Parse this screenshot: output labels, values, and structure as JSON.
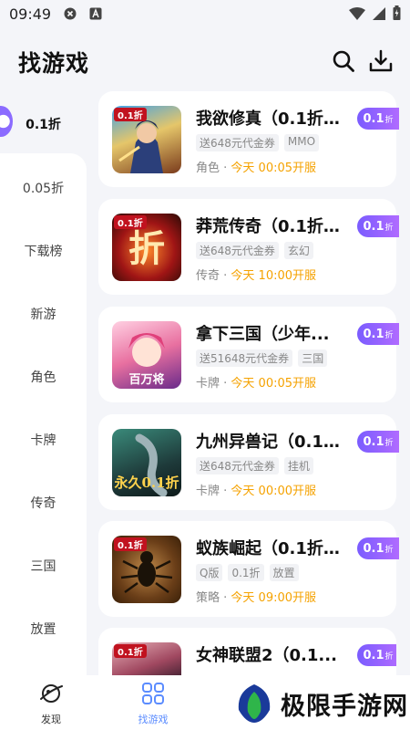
{
  "status": {
    "time": "09:49"
  },
  "header": {
    "title": "找游戏"
  },
  "sidebar": {
    "items": [
      {
        "label": "0.1折",
        "active": true
      },
      {
        "label": "0.05折"
      },
      {
        "label": "下载榜"
      },
      {
        "label": "新游"
      },
      {
        "label": "角色"
      },
      {
        "label": "卡牌"
      },
      {
        "label": "传奇"
      },
      {
        "label": "三国"
      },
      {
        "label": "放置"
      }
    ]
  },
  "games": [
    {
      "name": "我欲修真（0.1折...",
      "tags": [
        "送648元代金券",
        "MMO"
      ],
      "category": "角色",
      "open": "今天 00:05开服",
      "discount": "0.1",
      "discount_unit": "折"
    },
    {
      "name": "莽荒传奇（0.1折...",
      "tags": [
        "送648元代金券",
        "玄幻"
      ],
      "category": "传奇",
      "open": "今天 10:00开服",
      "discount": "0.1",
      "discount_unit": "折"
    },
    {
      "name": "拿下三国（少年...",
      "tags": [
        "送51648元代金券",
        "三国"
      ],
      "category": "卡牌",
      "open": "今天 00:05开服",
      "discount": "0.1",
      "discount_unit": "折"
    },
    {
      "name": "九州异兽记（0.1...",
      "tags": [
        "送648元代金券",
        "挂机"
      ],
      "category": "卡牌",
      "open": "今天 00:00开服",
      "discount": "0.1",
      "discount_unit": "折"
    },
    {
      "name": "蚁族崛起（0.1折...",
      "tags": [
        "Q版",
        "0.1折",
        "放置"
      ],
      "category": "策略",
      "open": "今天 09:00开服",
      "discount": "0.1",
      "discount_unit": "折"
    },
    {
      "name": "女神联盟2（0.1...",
      "tags": [],
      "category": "",
      "open": "",
      "discount": "0.1",
      "discount_unit": "折"
    }
  ],
  "icon_badges": {
    "g0": "0.1折",
    "g1": "0.1折",
    "g4": "0.1折",
    "g5": "0.1折"
  },
  "tabbar": {
    "discover": "发现",
    "find_games": "找游戏"
  },
  "watermark": {
    "text": "极限手游网"
  },
  "colors": {
    "accent": "#7a5cff",
    "open_time": "#f5a200",
    "tab_active": "#5b8cff"
  }
}
